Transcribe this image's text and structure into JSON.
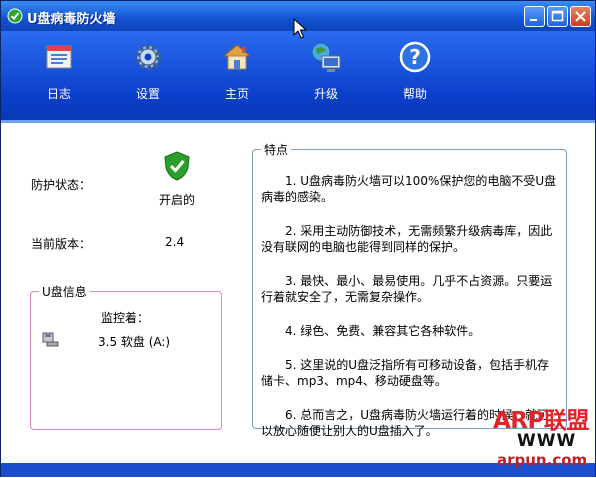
{
  "window": {
    "title": "U盘病毒防火墙"
  },
  "toolbar": {
    "items": [
      {
        "label": "日志",
        "icon": "log-icon"
      },
      {
        "label": "设置",
        "icon": "gear-icon"
      },
      {
        "label": "主页",
        "icon": "home-icon"
      },
      {
        "label": "升级",
        "icon": "upgrade-icon"
      },
      {
        "label": "帮助",
        "icon": "help-icon"
      }
    ]
  },
  "status": {
    "protection_label": "防护状态：",
    "protection_value": "开启的",
    "version_label": "当前版本：",
    "version_value": "2.4"
  },
  "usb_info": {
    "legend": "U盘信息",
    "monitor_label": "监控着：",
    "drive": "3.5 软盘 (A:)"
  },
  "features": {
    "legend": "特点",
    "items": [
      "1. U盘病毒防火墙可以100%保护您的电脑不受U盘病毒的感染。",
      "2. 采用主动防御技术，无需频繁升级病毒库，因此没有联网的电脑也能得到同样的保护。",
      "3. 最快、最小、最易使用。几乎不占资源。只要运行着就安全了，无需复杂操作。",
      "4. 绿色、免费、兼容其它各种软件。",
      "5. 这里说的U盘泛指所有可移动设备，包括手机存储卡、mp3、mp4、移动硬盘等。",
      "6. 总而言之，U盘病毒防火墙运行着的时候，就可以放心随便让别人的U盘插入了。"
    ]
  },
  "watermark": {
    "line1": "ARP联盟",
    "line2": "WWW",
    "line3": "arpun.com"
  },
  "colors": {
    "title_bar": "#1252d2",
    "toolbar": "#0b3fcb",
    "fieldset_pink": "#d38ac6",
    "fieldset_blue": "#7a9cd0",
    "watermark_red": "#e0242c"
  }
}
